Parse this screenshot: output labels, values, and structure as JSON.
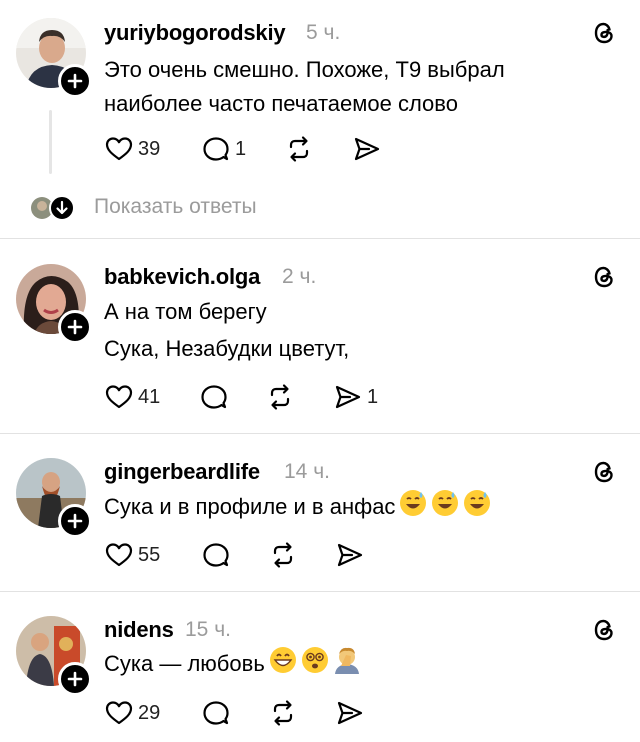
{
  "posts": [
    {
      "username": "yuriybogorodskiy",
      "time": "5 ч.",
      "lines": [
        "Это очень смешно. Похоже, Т9 выбрал",
        "наиболее часто печатаемое слово"
      ],
      "likes": "39",
      "replies": "1",
      "reposts": "",
      "shares": ""
    },
    {
      "username": "babkevich.olga",
      "time": "2 ч.",
      "lines": [
        "А на том берегу",
        "Сука, Незабудки цветут,"
      ],
      "likes": "41",
      "replies": "",
      "reposts": "",
      "shares": "1"
    },
    {
      "username": "gingerbeardlife",
      "time": "14 ч.",
      "lines": [
        "Сука и в профиле и в анфас"
      ],
      "likes": "55",
      "replies": "",
      "reposts": "",
      "shares": ""
    },
    {
      "username": "nidens",
      "time": "15 ч.",
      "lines": [
        "Сука — любовь"
      ],
      "likes": "29",
      "replies": "",
      "reposts": "",
      "shares": ""
    }
  ],
  "show_replies": "Показать ответы",
  "icons": {
    "like": "heart-icon",
    "reply": "comment-icon",
    "repost": "repost-icon",
    "share": "share-icon",
    "more": "threads-icon",
    "follow": "plus-icon"
  },
  "colors": {
    "muted": "#9b9b9b",
    "divider": "#e2e2e2",
    "accent": "#000000"
  }
}
